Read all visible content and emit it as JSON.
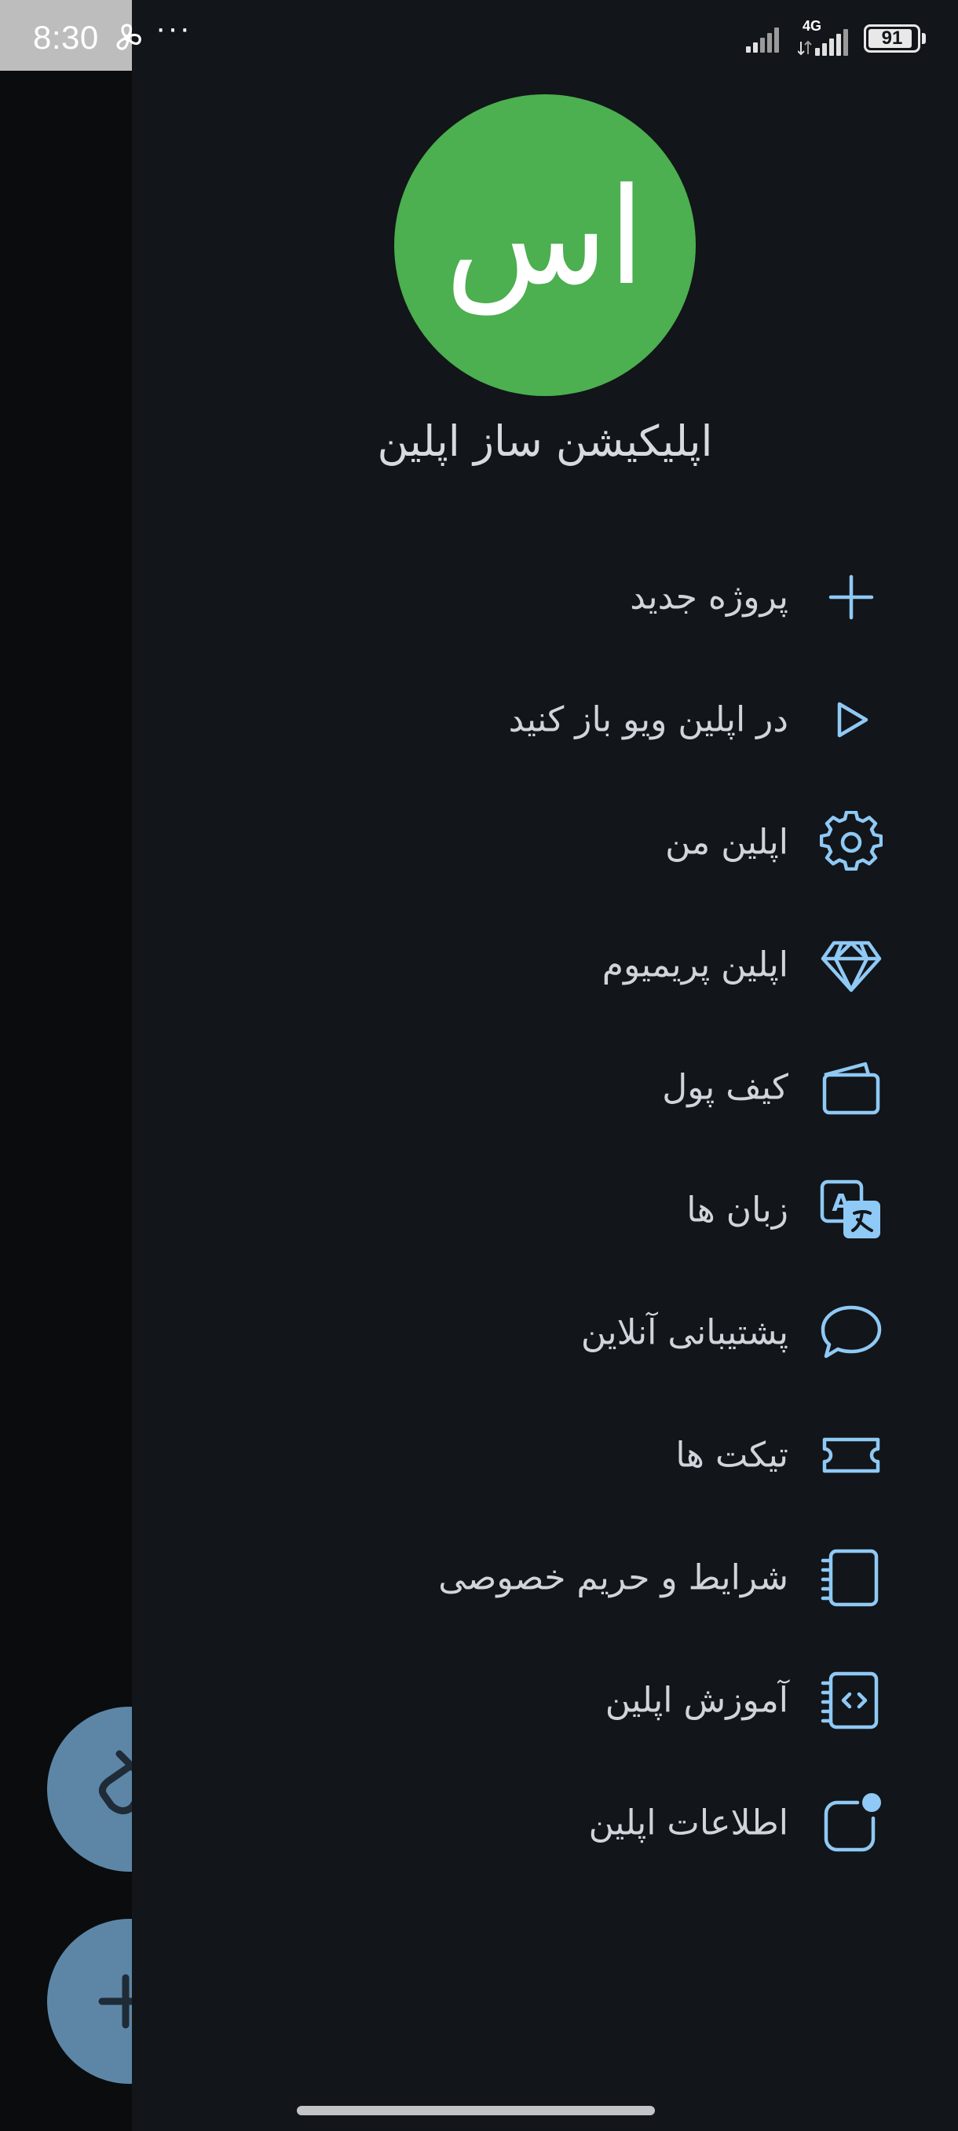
{
  "status_bar": {
    "time": "8:30",
    "more_dots": "···",
    "network_type": "4G",
    "battery_level": "91",
    "battery_fraction": 0.91
  },
  "profile": {
    "avatar_initials": "اس",
    "avatar_color": "#4caf50",
    "name": "اپلیکیشن ساز اپلین"
  },
  "colors": {
    "drawer_background": "#121519",
    "icon_accent": "#8fc9f5",
    "fab_color": "#5d86a6"
  },
  "menu": [
    {
      "label": "پروژه جدید",
      "icon": "plus-icon"
    },
    {
      "label": "در اپلین ویو باز کنید",
      "icon": "play-icon"
    },
    {
      "label": "اپلین من",
      "icon": "gear-icon"
    },
    {
      "label": "اپلین پریمیوم",
      "icon": "diamond-icon"
    },
    {
      "label": "کیف پول",
      "icon": "wallet-icon"
    },
    {
      "label": "زبان ها",
      "icon": "translate-icon"
    },
    {
      "label": "پشتیبانی آنلاین",
      "icon": "chat-bubble-icon"
    },
    {
      "label": "تیکت ها",
      "icon": "ticket-icon"
    },
    {
      "label": "شرایط و حریم خصوصی",
      "icon": "notebook-icon"
    },
    {
      "label": "آموزش اپلین",
      "icon": "code-book-icon"
    },
    {
      "label": "اطلاعات اپلین",
      "icon": "notification-dot-icon"
    }
  ],
  "background_fabs": [
    {
      "icon": "brush-icon"
    },
    {
      "icon": "plus-icon"
    }
  ]
}
